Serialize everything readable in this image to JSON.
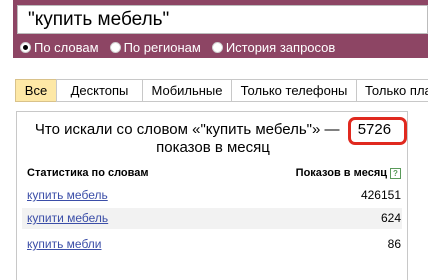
{
  "search": {
    "query": "\"купить мебель\""
  },
  "radios": [
    {
      "label": "По словам",
      "checked": true
    },
    {
      "label": "По регионам",
      "checked": false
    },
    {
      "label": "История запросов",
      "checked": false
    }
  ],
  "tabs": [
    {
      "label": "Все",
      "active": true
    },
    {
      "label": "Десктопы",
      "active": false
    },
    {
      "label": "Мобильные",
      "active": false
    },
    {
      "label": "Только телефоны",
      "active": false
    },
    {
      "label": "Только планшеты",
      "active": false
    }
  ],
  "summary": {
    "prefix": "Что искали со словом «\"купить мебель\"» —",
    "count": "5726",
    "suffix": "показов в месяц"
  },
  "table": {
    "col_phrase": "Статистика по словам",
    "col_shows": "Показов в месяц",
    "help_icon": "?",
    "rows": [
      {
        "phrase": "купить мебель",
        "shows": "426151"
      },
      {
        "phrase": "купити мебель",
        "shows": "624"
      },
      {
        "phrase": "купить мебли",
        "shows": "86"
      }
    ]
  },
  "colors": {
    "header_bg": "#8d4564",
    "active_tab": "#fde8a6",
    "link": "#3b4ea8",
    "highlight": "#e0291f"
  }
}
